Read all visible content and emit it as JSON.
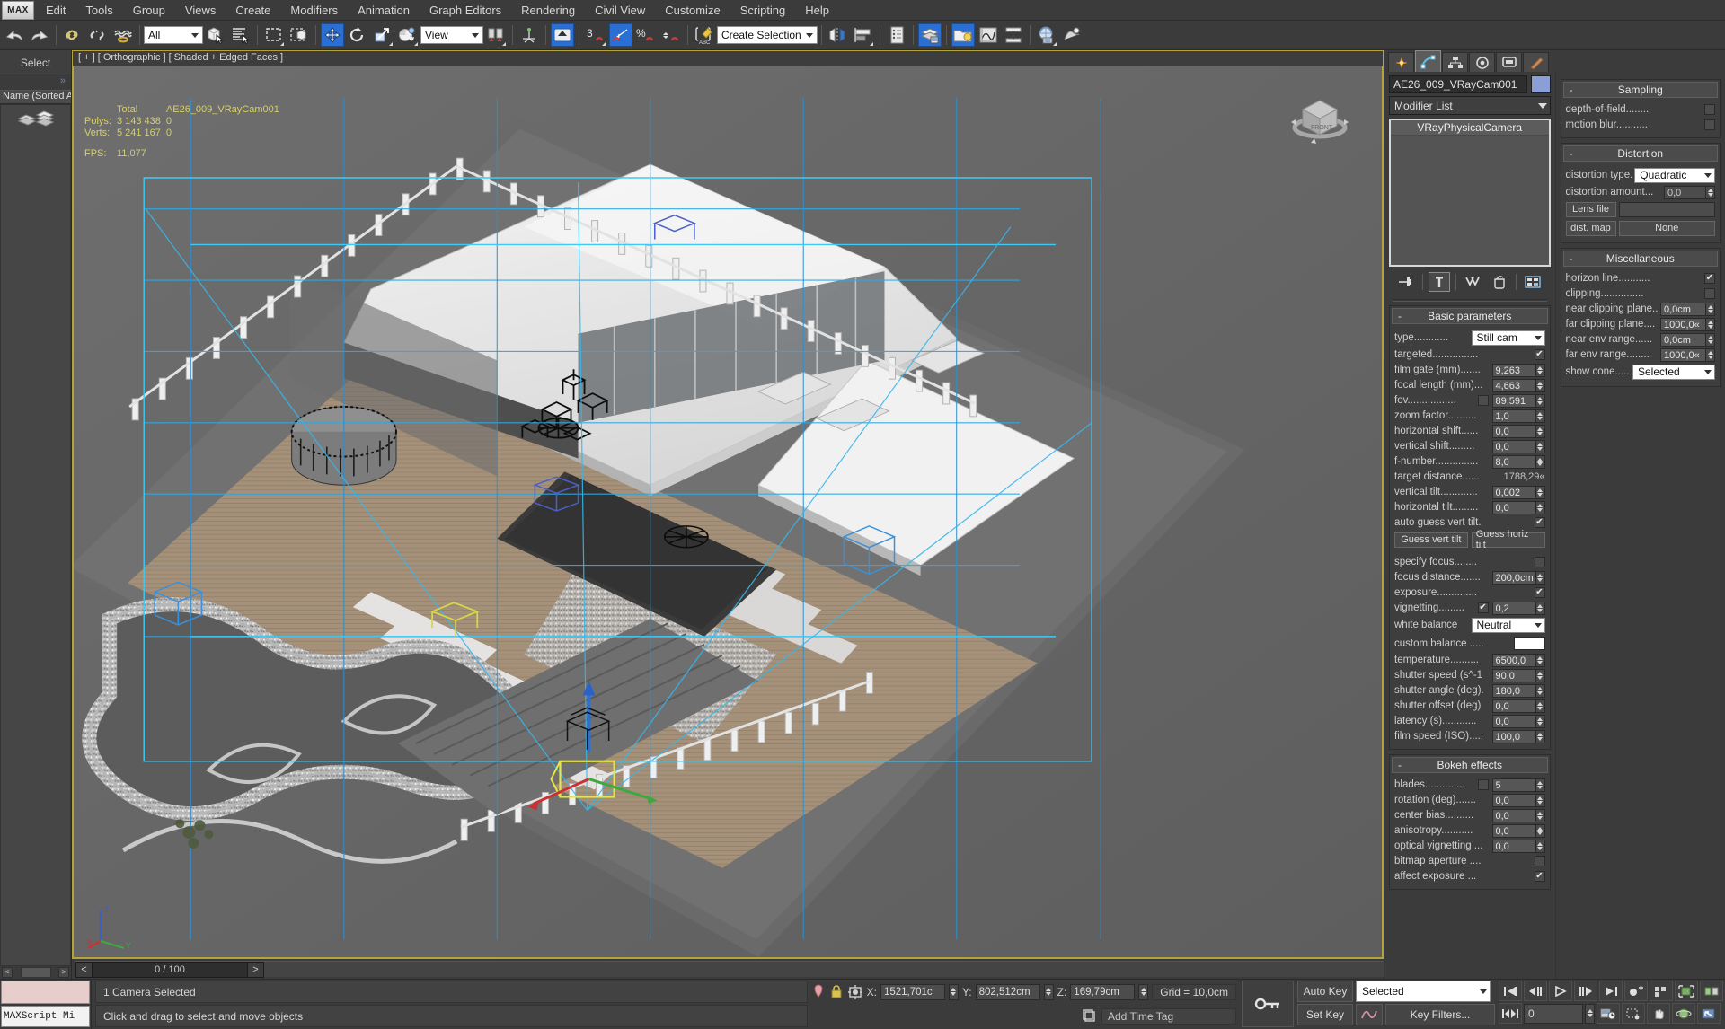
{
  "app": {
    "logo": "MAX"
  },
  "menu": {
    "items": [
      "Edit",
      "Tools",
      "Group",
      "Views",
      "Create",
      "Modifiers",
      "Animation",
      "Graph Editors",
      "Rendering",
      "Civil View",
      "Customize",
      "Scripting",
      "Help"
    ]
  },
  "toolbar": {
    "selection_filter": "All",
    "reference_coord": "View",
    "named_selection_sets": "Create Selection Se",
    "snap_toggle_label": "3",
    "percent_label": "%",
    "icons": [
      "undo-icon",
      "redo-icon",
      "select-link-icon",
      "unlink-icon",
      "bind-space-warp-icon",
      "select-object-icon",
      "select-by-name-icon",
      "rectangular-selection-region-icon",
      "window-crossing-icon",
      "select-and-move-icon",
      "select-and-rotate-icon",
      "select-and-scale-icon",
      "select-and-place-icon",
      "mirror-icon",
      "align-icon",
      "layer-manager-icon",
      "curve-editor-icon",
      "schematic-view-icon",
      "material-editor-icon",
      "render-setup-icon",
      "rendered-frame-window-icon",
      "render-production-icon"
    ]
  },
  "left_panel": {
    "title": "Select",
    "expand_glyph": "»",
    "column_header": "Name (Sorted Asc",
    "scroll_left": "<",
    "scroll_right": ">"
  },
  "viewport": {
    "label": "[ + ] [ Orthographic ] [ Shaded + Edged Faces ]",
    "stats": {
      "col_total": "Total",
      "col_selection": "AE26_009_VRayCam001",
      "polys_label": "Polys:",
      "polys_total": "3 143 438",
      "polys_sel": "0",
      "verts_label": "Verts:",
      "verts_total": "5 241 167",
      "verts_sel": "0",
      "fps_label": "FPS:",
      "fps_value": "11,077"
    },
    "axis": {
      "x": "X",
      "y": "Y",
      "z": "Z"
    }
  },
  "timeline": {
    "current": "0 / 100",
    "prev": "<",
    "next": ">"
  },
  "command_panel": {
    "tabs": [
      "create-tab",
      "modify-tab",
      "hierarchy-tab",
      "motion-tab",
      "display-tab",
      "utilities-tab"
    ],
    "object_name": "AE26_009_VRayCam001",
    "modifier_list": "Modifier List",
    "stack": [
      "VRayPhysicalCamera"
    ],
    "stack_buttons": [
      "pin-stack-icon",
      "show-end-result-icon",
      "make-unique-icon",
      "remove-modifier-icon",
      "configure-modifier-sets-icon"
    ],
    "basic_parameters": {
      "title": "Basic parameters",
      "type_label": "type............",
      "type_value": "Still cam",
      "rows": [
        {
          "label": "targeted................",
          "type": "check",
          "value": true
        },
        {
          "label": "film gate (mm).......",
          "type": "spin",
          "value": "9,263"
        },
        {
          "label": "focal length (mm)...",
          "type": "spin",
          "value": "4,663"
        },
        {
          "label": "fov.................",
          "type": "check-spin",
          "checked": false,
          "value": "89,591"
        },
        {
          "label": "zoom factor..........",
          "type": "spin",
          "value": "1,0"
        },
        {
          "label": "horizontal shift......",
          "type": "spin",
          "value": "0,0"
        },
        {
          "label": "vertical shift.........",
          "type": "spin",
          "value": "0,0"
        },
        {
          "label": "f-number...............",
          "type": "spin",
          "value": "8,0"
        },
        {
          "label": "target distance......",
          "type": "readonly",
          "value": "1788,29«"
        },
        {
          "label": "vertical tilt.............",
          "type": "spin",
          "value": "0,002"
        },
        {
          "label": "horizontal tilt.........",
          "type": "spin",
          "value": "0,0"
        },
        {
          "label": "auto guess vert tilt.",
          "type": "check",
          "value": true
        }
      ],
      "guess_vert_btn": "Guess vert tilt",
      "guess_horiz_btn": "Guess horiz tilt",
      "rows2": [
        {
          "label": "specify focus........",
          "type": "check",
          "value": false
        },
        {
          "label": "focus distance.......",
          "type": "spin",
          "value": "200,0cm"
        },
        {
          "label": "exposure..............",
          "type": "check",
          "value": true
        },
        {
          "label": "vignetting.........",
          "type": "check-spin",
          "checked": true,
          "value": "0,2"
        }
      ],
      "white_balance_label": "white balance",
      "white_balance_value": "Neutral",
      "custom_balance_label": "custom balance .....",
      "rows3": [
        {
          "label": "temperature..........",
          "type": "spin",
          "value": "6500,0"
        },
        {
          "label": "shutter speed (s^-1",
          "type": "spin",
          "value": "90,0"
        },
        {
          "label": "shutter angle (deg).",
          "type": "spin",
          "value": "180,0"
        },
        {
          "label": "shutter offset (deg)",
          "type": "spin",
          "value": "0,0"
        },
        {
          "label": "latency (s)............",
          "type": "spin",
          "value": "0,0"
        },
        {
          "label": "film speed (ISO).....",
          "type": "spin",
          "value": "100,0"
        }
      ]
    },
    "bokeh": {
      "title": "Bokeh effects",
      "rows": [
        {
          "label": "blades..............",
          "type": "check-spin",
          "checked": false,
          "value": "5"
        },
        {
          "label": "rotation (deg).......",
          "type": "spin",
          "value": "0,0"
        },
        {
          "label": "center bias..........",
          "type": "spin",
          "value": "0,0"
        },
        {
          "label": "anisotropy...........",
          "type": "spin",
          "value": "0,0"
        },
        {
          "label": "optical vignetting ...",
          "type": "spin",
          "value": "0,0"
        },
        {
          "label": "bitmap aperture ....",
          "type": "check",
          "value": false
        },
        {
          "label": "affect exposure ...",
          "type": "check",
          "value": true
        }
      ]
    },
    "sampling": {
      "title": "Sampling",
      "rows": [
        {
          "label": "depth-of-field........",
          "type": "check",
          "value": false
        },
        {
          "label": "motion blur...........",
          "type": "check",
          "value": false
        }
      ]
    },
    "distortion": {
      "title": "Distortion",
      "type_label": "distortion type.",
      "type_value": "Quadratic",
      "amount_label": "distortion amount...",
      "amount_value": "0,0",
      "lens_file_btn": "Lens file",
      "lens_file_value": "",
      "dist_map_btn": "dist. map",
      "dist_map_value": "None"
    },
    "miscellaneous": {
      "title": "Miscellaneous",
      "rows": [
        {
          "label": "horizon line...........",
          "type": "check",
          "value": true
        },
        {
          "label": "clipping...............",
          "type": "check",
          "value": false
        },
        {
          "label": "near clipping plane..",
          "type": "spin",
          "value": "0,0cm"
        },
        {
          "label": "far clipping plane....",
          "type": "spin",
          "value": "1000,0«"
        },
        {
          "label": "near env range......",
          "type": "spin",
          "value": "0,0cm"
        },
        {
          "label": "far env range........",
          "type": "spin",
          "value": "1000,0«"
        }
      ],
      "show_cone_label": "show cone.....",
      "show_cone_value": "Selected"
    }
  },
  "status": {
    "maxscript_label": "MAXScript Mi",
    "selection_text": "1 Camera Selected",
    "prompt_text": "Click and drag to select and move objects",
    "coords": {
      "x_label": "X:",
      "x_value": "1521,701c",
      "y_label": "Y:",
      "y_value": "802,512cm",
      "z_label": "Z:",
      "z_value": "169,79cm"
    },
    "grid_label": "Grid = 10,0cm",
    "add_time_tag": "Add Time Tag",
    "auto_key": "Auto Key",
    "set_key": "Set Key",
    "key_mode": "Selected",
    "key_filters": "Key Filters...",
    "frame_field": "0",
    "icons": [
      "pin-stack-icon",
      "lock-selection-icon",
      "absolute-relative-transform-icon",
      "key-mode-icon",
      "curve-editor-icon",
      "goto-start-icon",
      "prev-frame-icon",
      "play-icon",
      "next-frame-icon",
      "goto-end-icon",
      "zoom-extents-icon",
      "pan-icon",
      "orbit-icon",
      "maximize-viewport-icon"
    ]
  }
}
